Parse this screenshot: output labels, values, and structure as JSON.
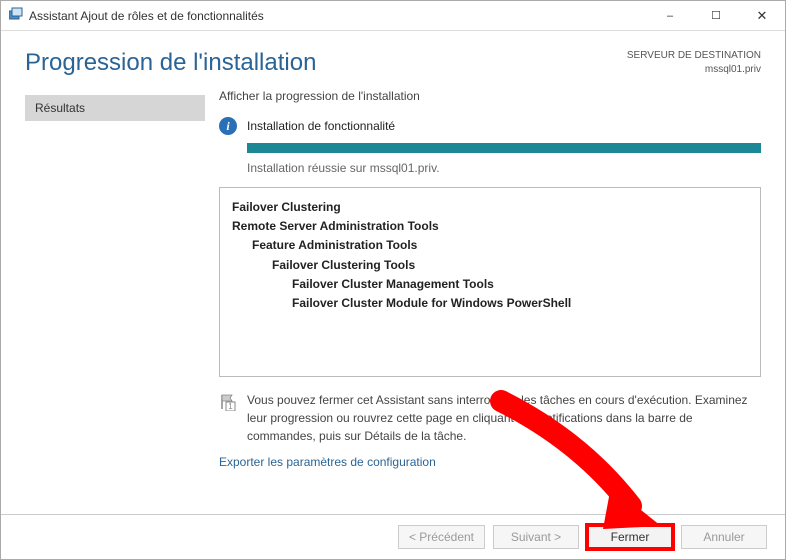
{
  "titlebar": {
    "title": "Assistant Ajout de rôles et de fonctionnalités"
  },
  "header": {
    "title": "Progression de l'installation",
    "destination_label": "SERVEUR DE DESTINATION",
    "destination_value": "mssql01.priv"
  },
  "sidebar": {
    "active_step": "Résultats"
  },
  "main": {
    "subhead": "Afficher la progression de l'installation",
    "status_title": "Installation de fonctionnalité",
    "status_message": "Installation réussie sur mssql01.priv.",
    "progress_percent": 100,
    "features": [
      {
        "level": 0,
        "label": "Failover Clustering"
      },
      {
        "level": 0,
        "label": "Remote Server Administration Tools"
      },
      {
        "level": 2,
        "label": "Feature Administration Tools"
      },
      {
        "level": 3,
        "label": "Failover Clustering Tools"
      },
      {
        "level": 4,
        "label": "Failover Cluster Management Tools"
      },
      {
        "level": 4,
        "label": "Failover Cluster Module for Windows PowerShell"
      }
    ],
    "note": "Vous pouvez fermer cet Assistant sans interrompre les tâches en cours d'exécution. Examinez leur progression ou rouvrez cette page en cliquant sur Notifications dans la barre de commandes, puis sur Détails de la tâche.",
    "export_link": "Exporter les paramètres de configuration"
  },
  "footer": {
    "prev": "< Précédent",
    "next": "Suivant >",
    "close": "Fermer",
    "cancel": "Annuler"
  },
  "annotation": {
    "highlighted_button": "close"
  }
}
